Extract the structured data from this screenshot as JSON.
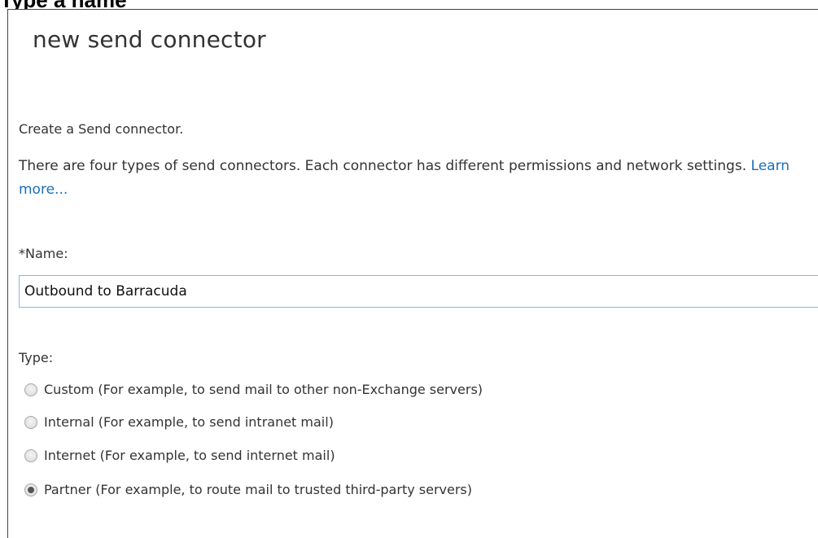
{
  "clipped_heading": "Type a name",
  "dialog": {
    "title": "new send connector",
    "intro": "Create a Send connector.",
    "description": "There are four types of send connectors. Each connector has different permissions and network settings.",
    "learn_more": "Learn more..."
  },
  "name_field": {
    "label": "*Name:",
    "value": "Outbound to Barracuda"
  },
  "type_field": {
    "label": "Type:",
    "options": [
      {
        "label": "Custom (For example, to send mail to other non-Exchange servers)",
        "selected": false
      },
      {
        "label": "Internal (For example, to send intranet mail)",
        "selected": false
      },
      {
        "label": "Internet (For example, to send internet mail)",
        "selected": false
      },
      {
        "label": "Partner (For example, to route mail to trusted third-party servers)",
        "selected": true
      }
    ]
  }
}
